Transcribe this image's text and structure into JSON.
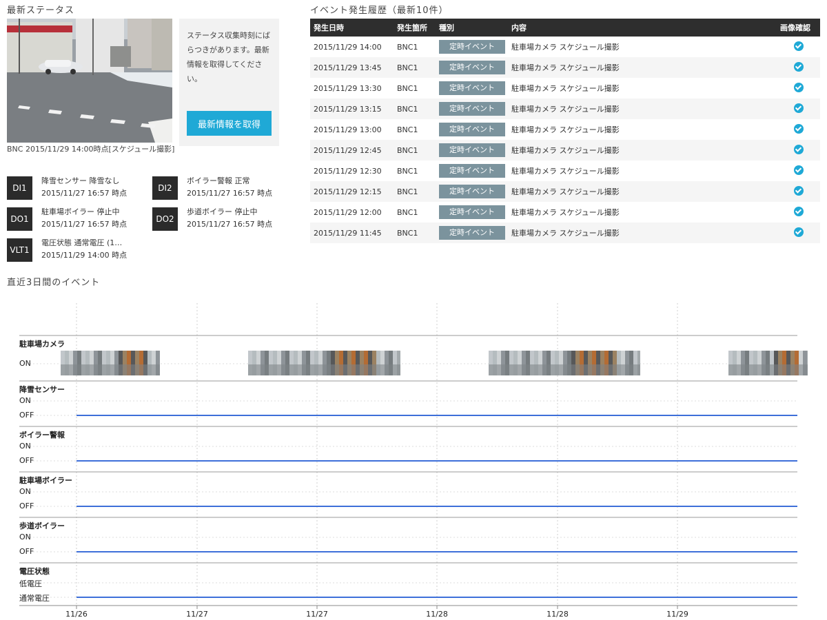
{
  "status": {
    "title": "最新ステータス",
    "camera_caption": "BNC 2015/11/29 14:00時点[スケジュール撮影]",
    "notice": "ステータス収集時刻にばらつきがあります。最新情報を取得してください。",
    "refresh_button": "最新情報を取得",
    "io": [
      {
        "badge": "DI1",
        "line1": "降雪センサー 降雪なし",
        "line2": "2015/11/27 16:57 時点"
      },
      {
        "badge": "DI2",
        "line1": "ボイラー警報 正常",
        "line2": "2015/11/27 16:57 時点"
      },
      {
        "badge": "DO1",
        "line1": "駐車場ボイラー 停止中",
        "line2": "2015/11/27 16:57 時点"
      },
      {
        "badge": "DO2",
        "line1": "歩道ボイラー 停止中",
        "line2": "2015/11/27 16:57 時点"
      },
      {
        "badge": "VLT1",
        "line1": "電圧状態 通常電圧 (1…",
        "line2": "2015/11/29 14:00 時点"
      }
    ]
  },
  "events": {
    "title": "イベント発生履歴（最新10件）",
    "columns": [
      "発生日時",
      "発生箇所",
      "種別",
      "内容",
      "画像確認"
    ],
    "rows": [
      {
        "datetime": "2015/11/29 14:00",
        "location": "BNC1",
        "type": "定時イベント",
        "content": "駐車場カメラ スケジュール撮影"
      },
      {
        "datetime": "2015/11/29 13:45",
        "location": "BNC1",
        "type": "定時イベント",
        "content": "駐車場カメラ スケジュール撮影"
      },
      {
        "datetime": "2015/11/29 13:30",
        "location": "BNC1",
        "type": "定時イベント",
        "content": "駐車場カメラ スケジュール撮影"
      },
      {
        "datetime": "2015/11/29 13:15",
        "location": "BNC1",
        "type": "定時イベント",
        "content": "駐車場カメラ スケジュール撮影"
      },
      {
        "datetime": "2015/11/29 13:00",
        "location": "BNC1",
        "type": "定時イベント",
        "content": "駐車場カメラ スケジュール撮影"
      },
      {
        "datetime": "2015/11/29 12:45",
        "location": "BNC1",
        "type": "定時イベント",
        "content": "駐車場カメラ スケジュール撮影"
      },
      {
        "datetime": "2015/11/29 12:30",
        "location": "BNC1",
        "type": "定時イベント",
        "content": "駐車場カメラ スケジュール撮影"
      },
      {
        "datetime": "2015/11/29 12:15",
        "location": "BNC1",
        "type": "定時イベント",
        "content": "駐車場カメラ スケジュール撮影"
      },
      {
        "datetime": "2015/11/29 12:00",
        "location": "BNC1",
        "type": "定時イベント",
        "content": "駐車場カメラ スケジュール撮影"
      },
      {
        "datetime": "2015/11/29 11:45",
        "location": "BNC1",
        "type": "定時イベント",
        "content": "駐車場カメラ スケジュール撮影"
      }
    ]
  },
  "timeline": {
    "title": "直近3日間のイベント",
    "line_color": "#3d6fd9"
  },
  "chart_data": {
    "type": "line",
    "title": "直近3日間のイベント",
    "x_ticks": [
      "11/26",
      "11/27",
      "11/27",
      "11/28",
      "11/28",
      "11/29"
    ],
    "series": [
      {
        "name": "駐車場カメラ",
        "levels": [
          "ON"
        ],
        "kind": "image-strip",
        "segments": 4
      },
      {
        "name": "降雪センサー",
        "levels": [
          "ON",
          "OFF"
        ],
        "value": "OFF"
      },
      {
        "name": "ボイラー警報",
        "levels": [
          "ON",
          "OFF"
        ],
        "value": "OFF"
      },
      {
        "name": "駐車場ボイラー",
        "levels": [
          "ON",
          "OFF"
        ],
        "value": "OFF"
      },
      {
        "name": "歩道ボイラー",
        "levels": [
          "ON",
          "OFF"
        ],
        "value": "OFF"
      },
      {
        "name": "電圧状態",
        "levels": [
          "低電圧",
          "通常電圧"
        ],
        "value": "通常電圧"
      }
    ]
  }
}
